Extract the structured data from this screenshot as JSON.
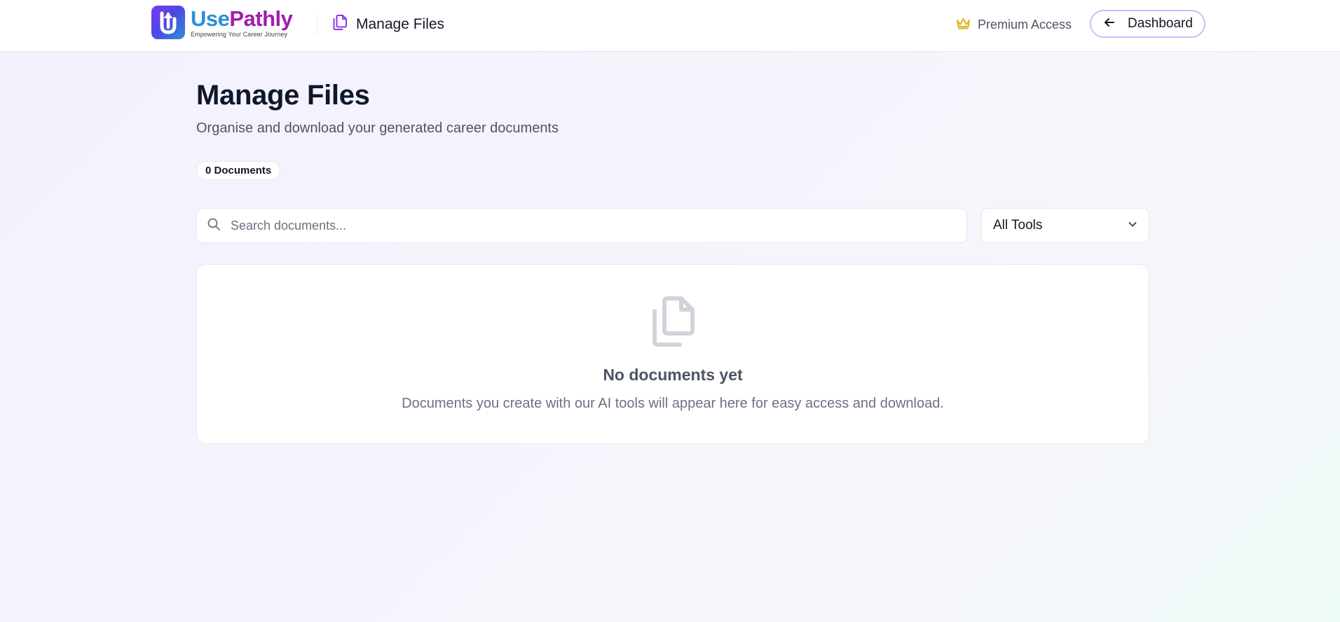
{
  "header": {
    "logo": {
      "name_part1": "Use",
      "name_part2": "Pathly",
      "tagline": "Empowering Your Career Journey"
    },
    "page_title": "Manage Files",
    "page_icon": "files-icon",
    "premium_label": "Premium Access",
    "premium_icon": "crown-icon",
    "dashboard_label": "Dashboard",
    "dashboard_icon": "arrow-left-icon"
  },
  "main": {
    "title": "Manage Files",
    "subtitle": "Organise and download your generated career documents",
    "document_count": "0 Documents",
    "search": {
      "placeholder": "Search documents...",
      "value": ""
    },
    "filter": {
      "selected": "All Tools"
    },
    "empty_state": {
      "icon": "files-icon",
      "title": "No documents yet",
      "description": "Documents you create with our AI tools will appear here for easy access and download."
    }
  },
  "colors": {
    "brand_blue": "#2b8fd6",
    "brand_magenta": "#a21caf",
    "accent_purple": "#9333ea",
    "crown_gold": "#e0b21b",
    "button_border": "#d8b4fe"
  }
}
